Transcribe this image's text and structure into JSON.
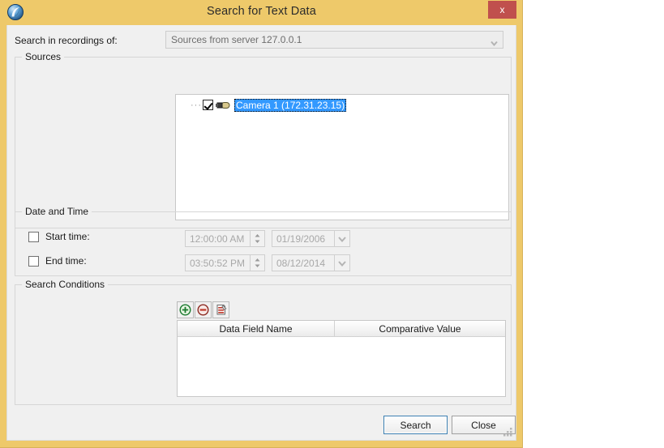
{
  "window": {
    "title": "Search for Text Data",
    "app_icon": "app-logo-icon",
    "close_label": "x",
    "frame_color": "#eec96a",
    "titlebar_text_color": "#2b2b2b",
    "close_button_color": "#c0504d"
  },
  "top": {
    "search_in_label": "Search in recordings of:",
    "source_combo": {
      "value": "Sources from server 127.0.0.1",
      "enabled": false,
      "arrow_icon": "chevron-down-icon"
    }
  },
  "sources": {
    "group_title": "Sources",
    "tree": [
      {
        "label": "Camera 1 (172.31.23.15)",
        "checked": true,
        "selected": true,
        "icon": "camera-icon",
        "selection_color": "#3399ff"
      }
    ]
  },
  "date_time": {
    "group_title": "Date and Time",
    "rows": [
      {
        "checkbox_label": "Start time:",
        "checked": false,
        "time_value": "12:00:00 AM",
        "date_value": "01/19/2006",
        "enabled": false,
        "spinner_icon": "spinner-up-down-icon",
        "date_arrow_icon": "chevron-down-icon"
      },
      {
        "checkbox_label": "End time:",
        "checked": false,
        "time_value": "03:50:52 PM",
        "date_value": "08/12/2014",
        "enabled": false,
        "spinner_icon": "spinner-up-down-icon",
        "date_arrow_icon": "chevron-down-icon"
      }
    ]
  },
  "search_conditions": {
    "group_title": "Search Conditions",
    "toolbar": [
      {
        "name": "add-condition-button",
        "icon": "plus-circle-green-icon",
        "tooltip": "Add"
      },
      {
        "name": "remove-condition-button",
        "icon": "minus-circle-red-icon",
        "tooltip": "Remove"
      },
      {
        "name": "clear-conditions-button",
        "icon": "clear-list-red-icon",
        "tooltip": "Clear"
      }
    ],
    "columns": [
      "Data Field Name",
      "Comparative Value"
    ],
    "rows": []
  },
  "footer": {
    "search_label": "Search",
    "close_label": "Close",
    "default_button": "Search",
    "resize_grip_icon": "resize-grip-icon"
  }
}
